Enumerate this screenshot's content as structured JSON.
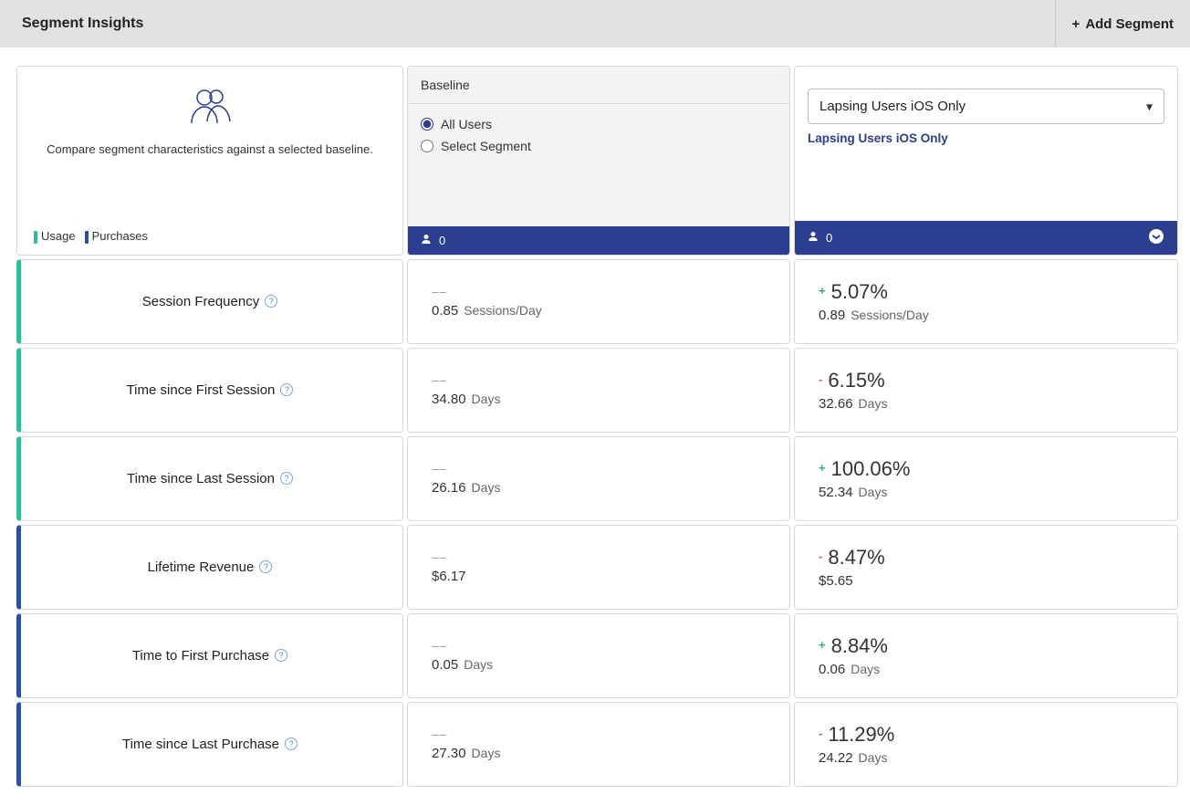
{
  "header": {
    "title": "Segment Insights",
    "add_segment": "Add Segment"
  },
  "intro": {
    "text": "Compare segment characteristics against a selected baseline.",
    "legend_usage": "Usage",
    "legend_purchases": "Purchases"
  },
  "baseline": {
    "title": "Baseline",
    "option_all": "All Users",
    "option_select": "Select Segment",
    "count": "0"
  },
  "segment": {
    "selected": "Lapsing Users iOS Only",
    "name": "Lapsing Users iOS Only",
    "count": "0"
  },
  "metrics": [
    {
      "category": "usage",
      "label": "Session Frequency",
      "baseline_delta": "−−",
      "baseline_value": "0.85",
      "baseline_unit": "Sessions/Day",
      "seg_sign": "+",
      "seg_delta": "5.07%",
      "seg_value": "0.89",
      "seg_unit": "Sessions/Day"
    },
    {
      "category": "usage",
      "label": "Time since First Session",
      "baseline_delta": "−−",
      "baseline_value": "34.80",
      "baseline_unit": "Days",
      "seg_sign": "-",
      "seg_delta": "6.15%",
      "seg_value": "32.66",
      "seg_unit": "Days"
    },
    {
      "category": "usage",
      "label": "Time since Last Session",
      "baseline_delta": "−−",
      "baseline_value": "26.16",
      "baseline_unit": "Days",
      "seg_sign": "+",
      "seg_delta": "100.06%",
      "seg_value": "52.34",
      "seg_unit": "Days"
    },
    {
      "category": "purchases",
      "label": "Lifetime Revenue",
      "baseline_delta": "−−",
      "baseline_value": "$6.17",
      "baseline_unit": "",
      "seg_sign": "-",
      "seg_delta": "8.47%",
      "seg_value": "$5.65",
      "seg_unit": ""
    },
    {
      "category": "purchases",
      "label": "Time to First Purchase",
      "baseline_delta": "−−",
      "baseline_value": "0.05",
      "baseline_unit": "Days",
      "seg_sign": "+",
      "seg_delta": "8.84%",
      "seg_value": "0.06",
      "seg_unit": "Days"
    },
    {
      "category": "purchases",
      "label": "Time since Last Purchase",
      "baseline_delta": "−−",
      "baseline_value": "27.30",
      "baseline_unit": "Days",
      "seg_sign": "-",
      "seg_delta": "11.29%",
      "seg_value": "24.22",
      "seg_unit": "Days"
    }
  ]
}
